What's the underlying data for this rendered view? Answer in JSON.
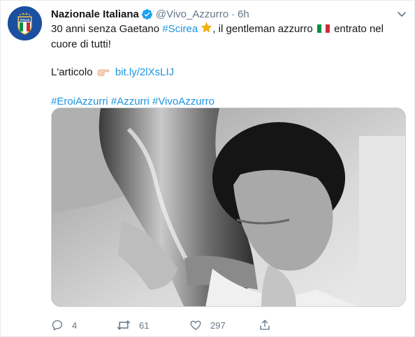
{
  "author": {
    "name": "Nazionale Italiana",
    "handle": "@Vivo_Azzurro",
    "separator": "·",
    "time": "6h",
    "avatar_text": "ITALIA"
  },
  "tweet": {
    "line1_prefix": "30 anni senza Gaetano ",
    "hashtag_scirea": "#Scirea",
    "line1_mid": ", il gentleman azzurro ",
    "line1_suffix": " entrato nel cuore di tutti!",
    "article_label": "L'articolo",
    "article_link": "bit.ly/2lXsLIJ",
    "hashtags": "#EroiAzzurri #Azzurri #VivoAzzurro"
  },
  "actions": {
    "replies": "4",
    "retweets": "61",
    "likes": "297"
  },
  "icons": {
    "verified": "verified-badge-icon",
    "caret": "chevron-down-icon",
    "star": "star-emoji-icon",
    "flag": "italy-flag-icon",
    "hand": "pointing-hand-icon",
    "reply": "reply-icon",
    "retweet": "retweet-icon",
    "like": "heart-icon",
    "share": "share-icon"
  },
  "colors": {
    "link": "#1b95e0",
    "secondary_text": "#657786",
    "verified": "#1da1f2",
    "avatar_bg": "#1b4fa0"
  }
}
